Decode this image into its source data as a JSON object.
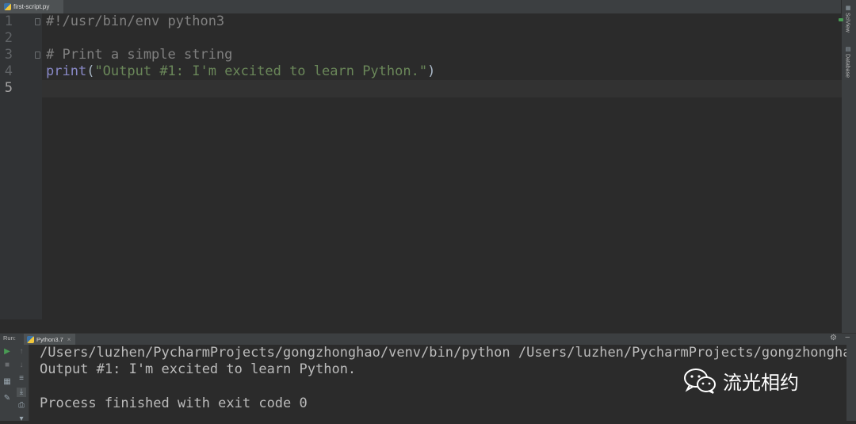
{
  "editor": {
    "tab": {
      "label": "first-script.py"
    },
    "lines": [
      {
        "num": "1",
        "text": "#!/usr/bin/env python3"
      },
      {
        "num": "2",
        "text": ""
      },
      {
        "num": "3",
        "text": "# Print a simple string"
      },
      {
        "num": "4",
        "builtin": "print",
        "open": "(",
        "string": "\"Output #1: I'm excited to learn Python.\"",
        "close": ")"
      },
      {
        "num": "5",
        "text": ""
      }
    ]
  },
  "right_tools": {
    "sciview": "SciView",
    "database": "Database"
  },
  "run_panel": {
    "title": "Run:",
    "tab_label": "Python3.7",
    "tab_close": "×",
    "settings_icon": "⚙",
    "minimize_icon": "–",
    "console": [
      "/Users/luzhen/PycharmProjects/gongzhonghao/venv/bin/python /Users/luzhen/PycharmProjects/gongzhonghao/first-script.py",
      "Output #1: I'm excited to learn Python.",
      "",
      "Process finished with exit code 0"
    ]
  },
  "watermark": {
    "text": "流光相约",
    "icon": "wechat-icon"
  },
  "colors": {
    "background": "#2b2b2b",
    "comment": "#808080",
    "builtin": "#8888c6",
    "string": "#6a8759",
    "run_green": "#499c54"
  }
}
